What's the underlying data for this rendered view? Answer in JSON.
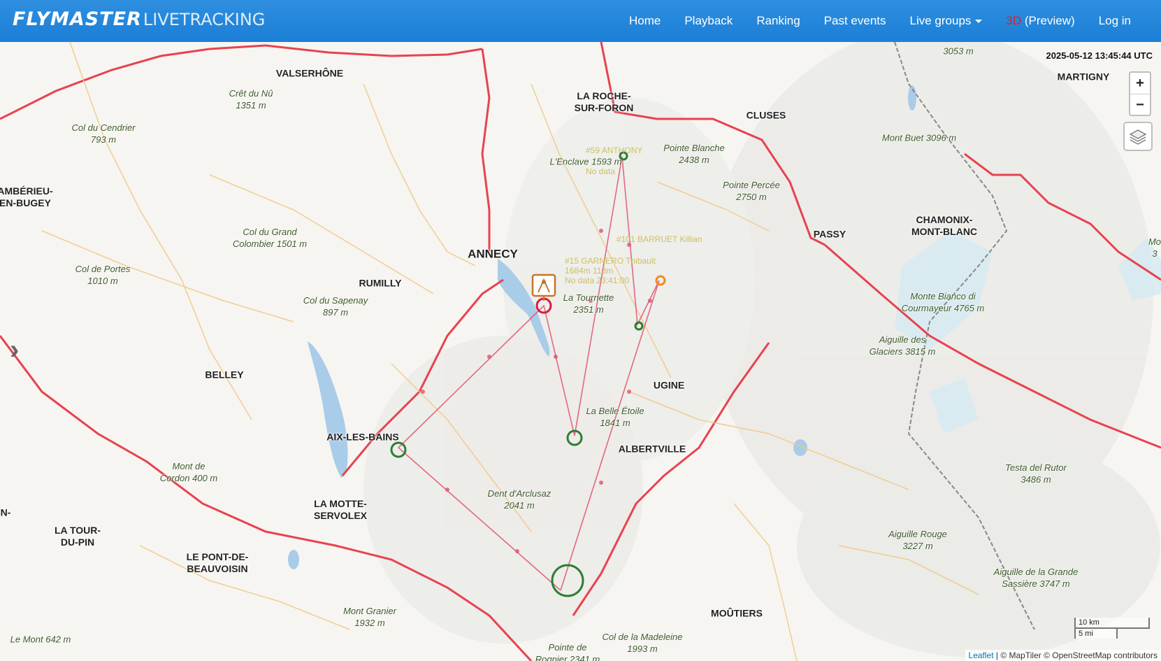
{
  "brand": {
    "bold": "FLYMASTER",
    "light": "LIVETRACKING"
  },
  "nav": {
    "home": "Home",
    "playback": "Playback",
    "ranking": "Ranking",
    "past_events": "Past events",
    "live_groups": "Live groups",
    "three_d": "3D",
    "preview": "(Preview)",
    "login": "Log in"
  },
  "map": {
    "timestamp": "2025-05-12 13:45:44 UTC",
    "zoom_in": "+",
    "zoom_out": "−",
    "scale_km": "10 km",
    "scale_mi": "5 mi",
    "attribution": {
      "leaflet": "Leaflet",
      "rest": " | © MapTiler © OpenStreetMap contributors"
    },
    "places": [
      {
        "name": "VALSERHÔNE",
        "big": false
      },
      {
        "name": "ANNECY",
        "big": true
      },
      {
        "name": "LA ROCHE-\nSUR-FORON",
        "big": false
      },
      {
        "name": "CLUSES",
        "big": false
      },
      {
        "name": "PASSY",
        "big": false
      },
      {
        "name": "CHAMONIX-\nMONT-BLANC",
        "big": false
      },
      {
        "name": "MARTIGNY",
        "big": false
      },
      {
        "name": "AMBÉRIEU-\nEN-BUGEY",
        "big": false
      },
      {
        "name": "RUMILLY",
        "big": false
      },
      {
        "name": "BELLEY",
        "big": false
      },
      {
        "name": "AIX-LES-BAINS",
        "big": false
      },
      {
        "name": "LA MOTTE-\nSERVOLEX",
        "big": false
      },
      {
        "name": "LA TOUR-\nDU-PIN",
        "big": false
      },
      {
        "name": "LE PONT-DE-\nBEAUVOISIN",
        "big": false
      },
      {
        "name": "UGINE",
        "big": false
      },
      {
        "name": "ALBERTVILLE",
        "big": false
      },
      {
        "name": "MOÛTIERS",
        "big": false
      },
      {
        "name": "N-",
        "big": false
      }
    ],
    "peaks": [
      {
        "name": "3053 m"
      },
      {
        "name": "Crêt du Nû\n1351 m"
      },
      {
        "name": "Col du Cendrier\n793 m"
      },
      {
        "name": "Pointe Blanche\n2438 m"
      },
      {
        "name": "L'Enclave 1593 m"
      },
      {
        "name": "Pointe Percée\n2750 m"
      },
      {
        "name": "Mont Buet 3096 m"
      },
      {
        "name": "Col du Grand\nColombier 1501 m"
      },
      {
        "name": "Col de Portes\n1010 m"
      },
      {
        "name": "Col du Sapenay\n897 m"
      },
      {
        "name": "La Tournette\n2351 m"
      },
      {
        "name": "Monte Bianco di\nCourmayeur 4765 m"
      },
      {
        "name": "Aiguille des\nGlaciers 3815 m"
      },
      {
        "name": "La Belle Étoile\n1841 m"
      },
      {
        "name": "Mont de\nCordon 400 m"
      },
      {
        "name": "Dent d'Arclusaz\n2041 m"
      },
      {
        "name": "Testa del Rutor\n3486 m"
      },
      {
        "name": "Aiguille Rouge\n3227 m"
      },
      {
        "name": "Aiguille de la Grande\nSassière 3747 m"
      },
      {
        "name": "Mont Granier\n1932 m"
      },
      {
        "name": "Col de la Madeleine\n1993 m"
      },
      {
        "name": "Pointe de\nRognier 2341 m"
      },
      {
        "name": "Le Mont 642 m"
      },
      {
        "name": "Mo\n3"
      }
    ],
    "pilot_labels": [
      {
        "text": "#59 ANTHONY"
      },
      {
        "text": "No data"
      },
      {
        "text": "#101 BARRUET Killian"
      },
      {
        "text": "#15 GARNERO Thibault"
      },
      {
        "text": "1684m 113m"
      },
      {
        "text": "No data 23:41:00"
      }
    ],
    "colors": {
      "route": "#e0506e",
      "turnpoint": "#2e7d32",
      "pilot_orange": "#f08a24",
      "goal_red": "#d81b3c",
      "lake": "#a9cce8"
    }
  }
}
